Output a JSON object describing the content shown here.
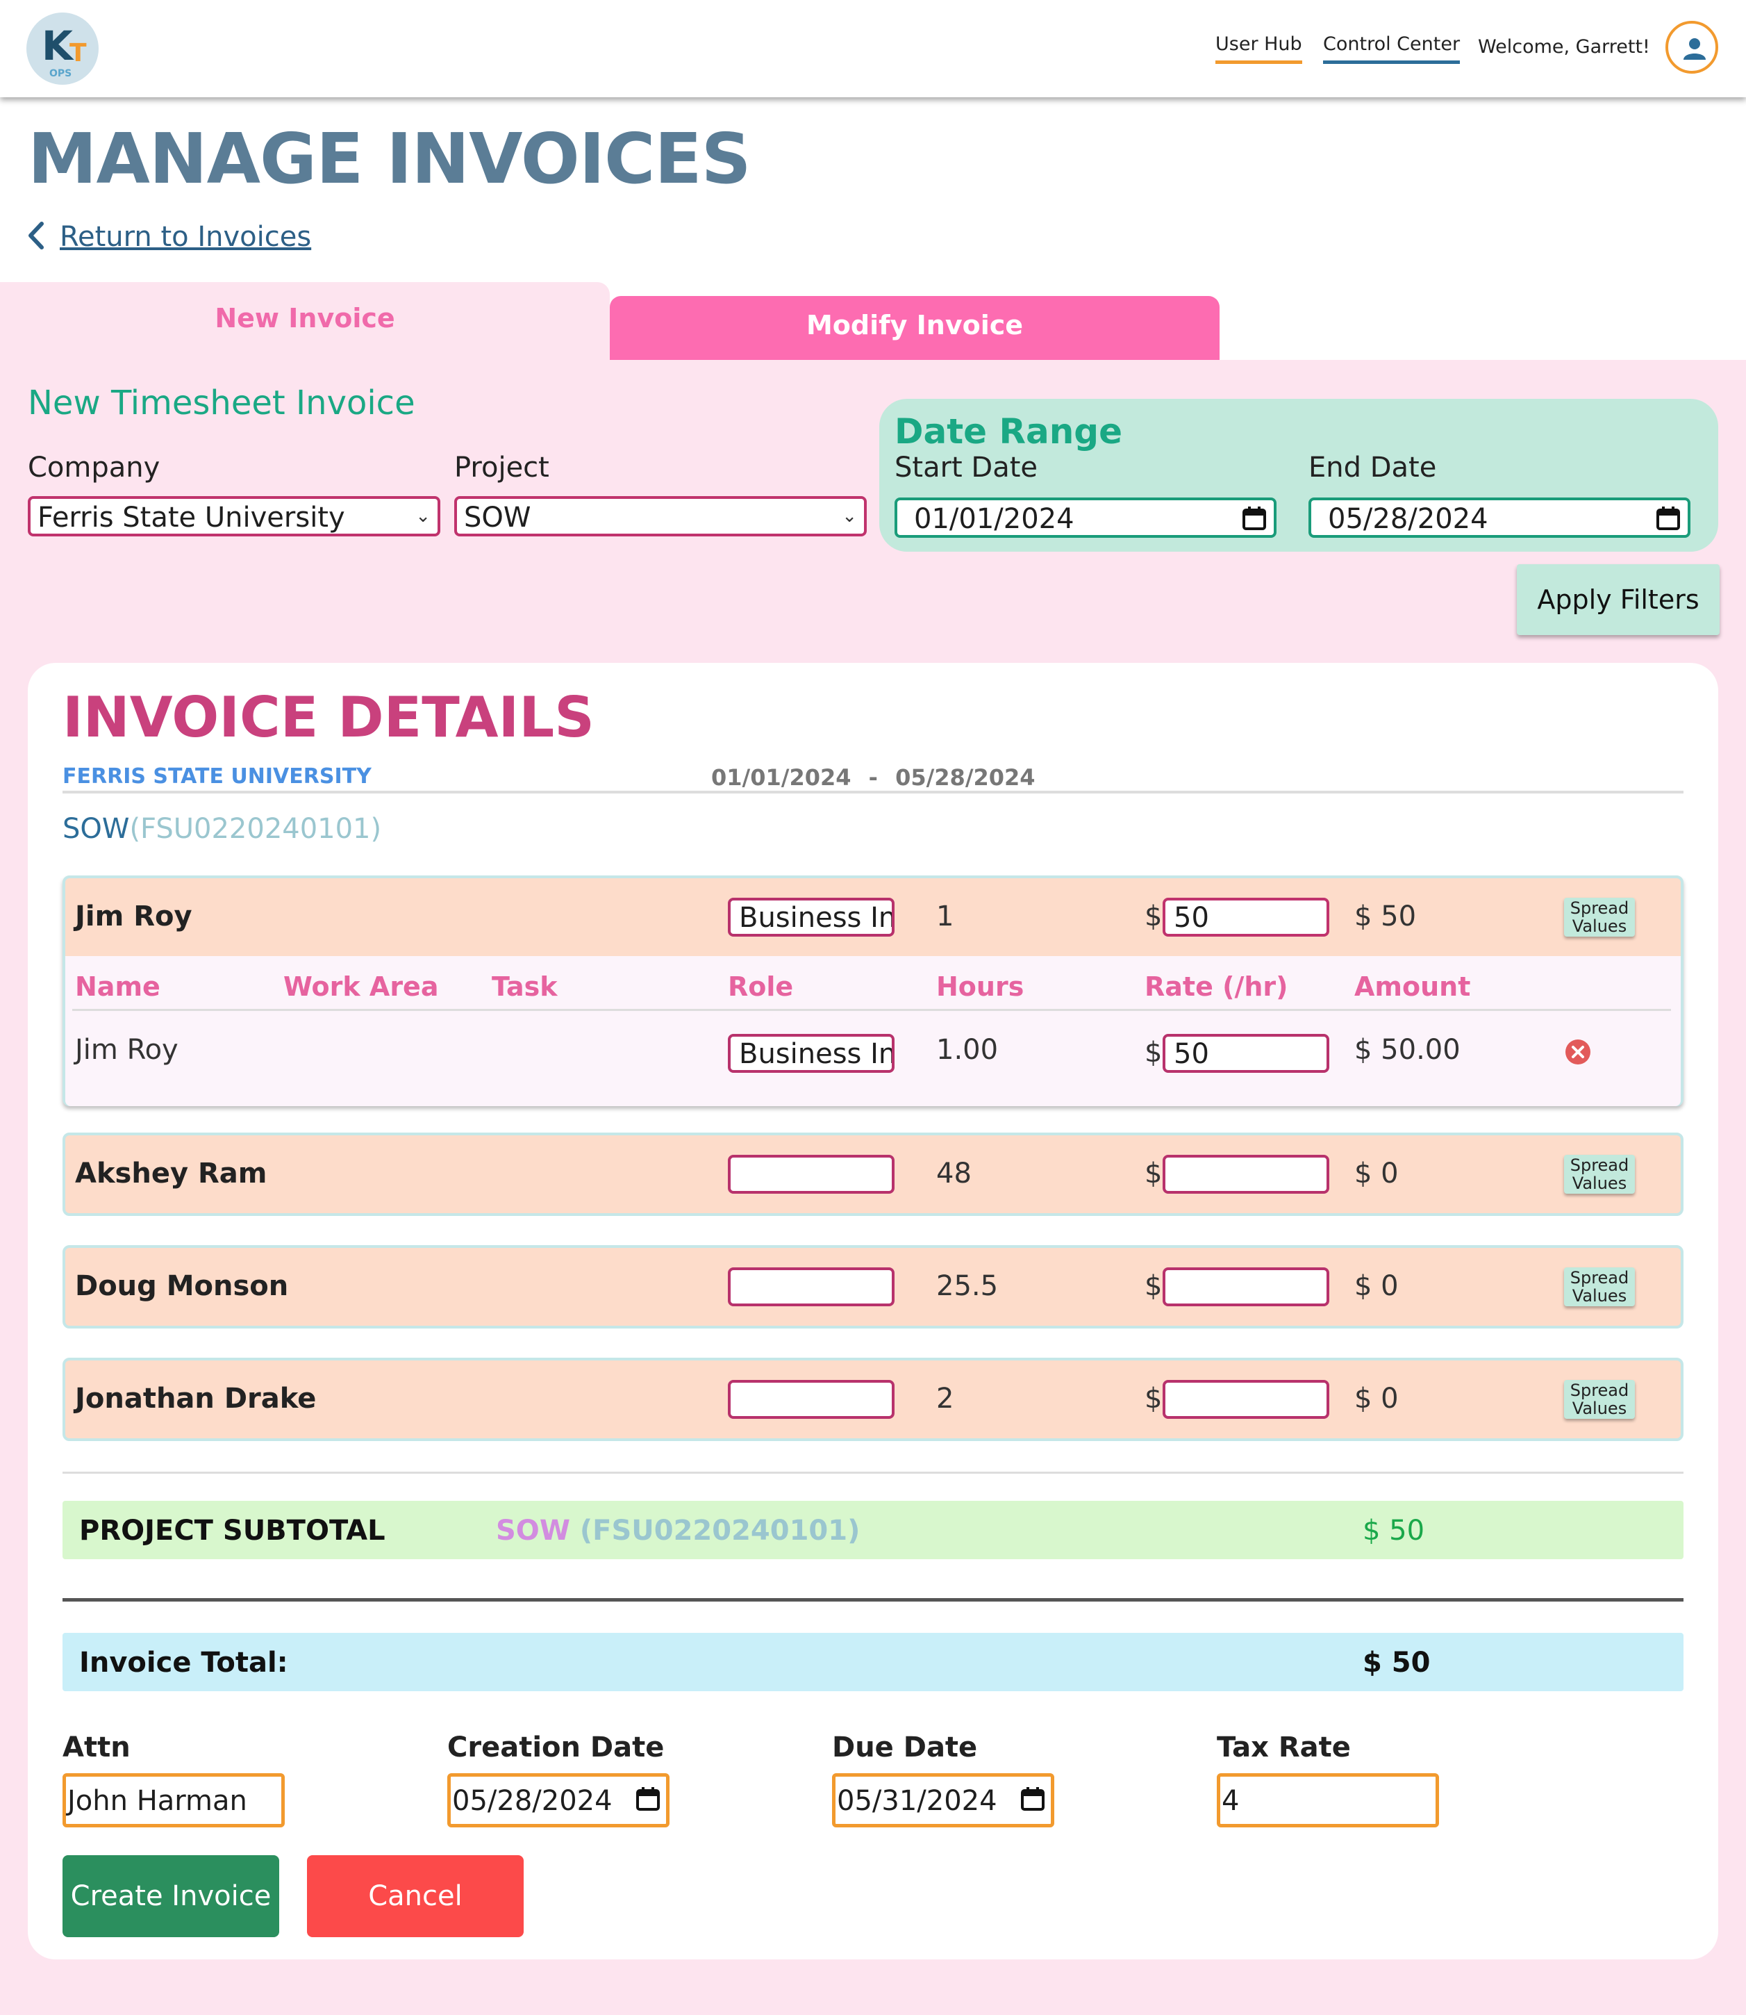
{
  "header": {
    "logo_text": "K",
    "logo_accent": "T",
    "logo_sub": "OPS",
    "nav": {
      "user_hub": "User Hub",
      "control_center": "Control Center"
    },
    "welcome": "Welcome, Garrett!",
    "avatar_icon": "user-icon"
  },
  "page": {
    "title": "MANAGE INVOICES",
    "back_link": "Return to Invoices"
  },
  "tabs": {
    "new": "New Invoice",
    "modify": "Modify Invoice",
    "active": "New Invoice"
  },
  "filters": {
    "section_title": "New Timesheet Invoice",
    "company_label": "Company",
    "company_value": "Ferris State University",
    "project_label": "Project",
    "project_value": "SOW",
    "date_range_title": "Date Range",
    "start_label": "Start Date",
    "start_value": "01/01/2024",
    "end_label": "End Date",
    "end_value": "05/28/2024",
    "apply_label": "Apply Filters"
  },
  "invoice": {
    "title": "INVOICE DETAILS",
    "company": "FERRIS STATE UNIVERSITY",
    "range_start": "01/01/2024",
    "range_sep": "-",
    "range_end": "05/28/2024",
    "project_name": "SOW",
    "project_code": "(FSU0220240101)",
    "columns": [
      "Name",
      "Work Area",
      "Task",
      "Role",
      "Hours",
      "Rate (/hr)",
      "Amount"
    ],
    "spread_label_1": "Spread",
    "spread_label_2": "Values",
    "currency": "$",
    "employees": [
      {
        "name": "Jim Roy",
        "role": "Business Int",
        "hours": "1",
        "rate": "50",
        "amount": "$ 50",
        "entries": [
          {
            "name": "Jim Roy",
            "work_area": "",
            "task": "",
            "role": "Business Int",
            "hours": "1.00",
            "rate": "50",
            "amount": "$ 50.00"
          }
        ]
      },
      {
        "name": "Akshey Ram",
        "role": "",
        "hours": "48",
        "rate": "",
        "amount": "$ 0"
      },
      {
        "name": "Doug Monson",
        "role": "",
        "hours": "25.5",
        "rate": "",
        "amount": "$ 0"
      },
      {
        "name": "Jonathan Drake",
        "role": "",
        "hours": "2",
        "rate": "",
        "amount": "$ 0"
      }
    ],
    "subtotal_label": "PROJECT SUBTOTAL",
    "subtotal_project": "SOW",
    "subtotal_code": "(FSU0220240101)",
    "subtotal_value": "$ 50",
    "total_label": "Invoice Total:",
    "total_value": "$ 50",
    "attn_label": "Attn",
    "attn_value": "John Harman",
    "creation_label": "Creation Date",
    "creation_value": "05/28/2024",
    "due_label": "Due Date",
    "due_value": "05/31/2024",
    "tax_label": "Tax Rate",
    "tax_value": "4",
    "create_label": "Create Invoice",
    "cancel_label": "Cancel"
  },
  "colors": {
    "brand_blue": "#5b7d96",
    "accent_orange": "#f29a2e",
    "pink": "#fd6cb1",
    "teal": "#c2e9dc",
    "invoice_magenta": "#c9417d",
    "create_green": "#2b8f5e",
    "cancel_red": "#fc4a4a"
  }
}
